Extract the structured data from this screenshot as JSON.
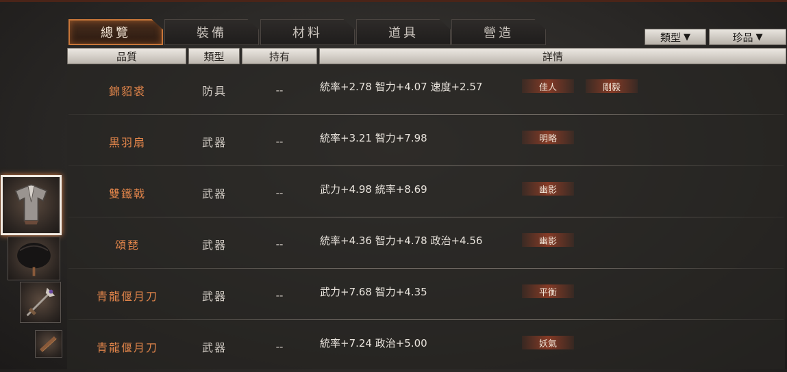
{
  "tabs": [
    {
      "label": "總覽",
      "active": true
    },
    {
      "label": "裝備",
      "active": false
    },
    {
      "label": "材料",
      "active": false
    },
    {
      "label": "道具",
      "active": false
    },
    {
      "label": "營造",
      "active": false
    }
  ],
  "filters": {
    "type_label": "類型",
    "rarity_label": "珍品",
    "arrow": "▼"
  },
  "columns": [
    "品質",
    "類型",
    "持有",
    "詳情"
  ],
  "rows": [
    {
      "name": "錦貂裘",
      "type": "防具",
      "held": "--",
      "stats": "統率+2.78 智力+4.07 速度+2.57",
      "tags": [
        "佳人",
        "剛毅"
      ]
    },
    {
      "name": "黒羽扇",
      "type": "武器",
      "held": "--",
      "stats": "統率+3.21 智力+7.98",
      "tags": [
        "明略"
      ]
    },
    {
      "name": "雙鐵戟",
      "type": "武器",
      "held": "--",
      "stats": "武力+4.98 統率+8.69",
      "tags": [
        "幽影"
      ]
    },
    {
      "name": "頌琵",
      "type": "武器",
      "held": "--",
      "stats": "統率+4.36 智力+4.78 政治+4.56",
      "tags": [
        "幽影"
      ]
    },
    {
      "name": "青龍偃月刀",
      "type": "武器",
      "held": "--",
      "stats": "武力+7.68 智力+4.35",
      "tags": [
        "平衡"
      ]
    },
    {
      "name": "青龍偃月刀",
      "type": "武器",
      "held": "--",
      "stats": "統率+7.24 政治+5.00",
      "tags": [
        "妖氣"
      ]
    }
  ],
  "thumbnails": [
    {
      "icon": "fur-coat-icon",
      "selected": true
    },
    {
      "icon": "feather-fan-icon",
      "selected": false
    },
    {
      "icon": "halberd-icon",
      "selected": false
    },
    {
      "icon": "lute-icon",
      "selected": false
    }
  ],
  "colors": {
    "accent": "#c8763a",
    "item_name": "#e0844a",
    "tag_bg": "#963e26"
  }
}
